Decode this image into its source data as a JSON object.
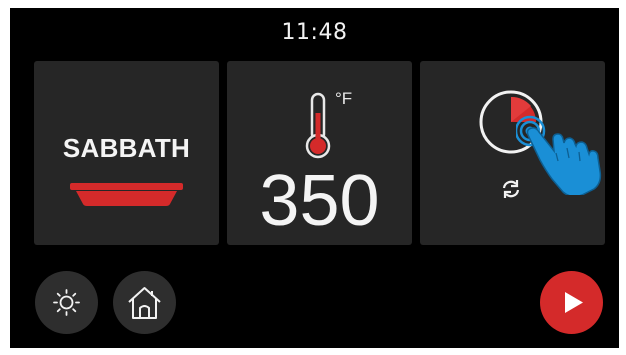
{
  "status_bar": {
    "time": "11:48"
  },
  "cards": {
    "mode": {
      "label": "SABBATH",
      "icon": "pan-icon"
    },
    "temperature": {
      "unit": "°F",
      "value": "350",
      "icon": "thermometer-icon"
    },
    "timer": {
      "icon": "timer-dial-icon",
      "secondary_icon": "repeat-icon",
      "overlay_icon": "hand-pointer-icon"
    }
  },
  "bottom_bar": {
    "light_button": {
      "icon": "light-icon"
    },
    "home_button": {
      "icon": "home-icon"
    },
    "start_button": {
      "icon": "play-icon"
    }
  },
  "colors": {
    "background": "#000000",
    "card": "#262626",
    "accent_red": "#d42a2a",
    "pointer_blue": "#1a8fd6",
    "text": "#f4f4f4"
  }
}
